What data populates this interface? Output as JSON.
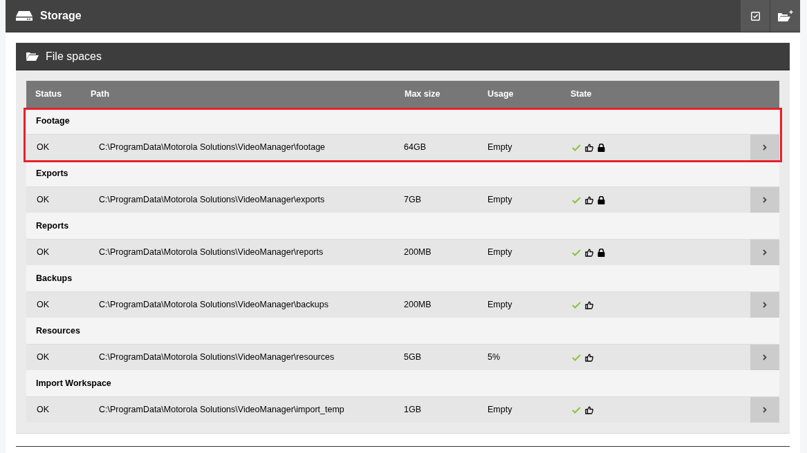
{
  "header": {
    "title": "Storage"
  },
  "panel": {
    "title": "File spaces"
  },
  "table": {
    "columns": [
      "Status",
      "Path",
      "Max size",
      "Usage",
      "State"
    ],
    "groups": [
      {
        "name": "Footage",
        "highlighted": true,
        "status": "OK",
        "path": "C:\\ProgramData\\Motorola Solutions\\VideoManager\\footage",
        "max_size": "64GB",
        "usage": "Empty",
        "healthy": true,
        "approved": true,
        "locked": true
      },
      {
        "name": "Exports",
        "highlighted": false,
        "status": "OK",
        "path": "C:\\ProgramData\\Motorola Solutions\\VideoManager\\exports",
        "max_size": "7GB",
        "usage": "Empty",
        "healthy": true,
        "approved": true,
        "locked": true
      },
      {
        "name": "Reports",
        "highlighted": false,
        "status": "OK",
        "path": "C:\\ProgramData\\Motorola Solutions\\VideoManager\\reports",
        "max_size": "200MB",
        "usage": "Empty",
        "healthy": true,
        "approved": true,
        "locked": true
      },
      {
        "name": "Backups",
        "highlighted": false,
        "status": "OK",
        "path": "C:\\ProgramData\\Motorola Solutions\\VideoManager\\backups",
        "max_size": "200MB",
        "usage": "Empty",
        "healthy": true,
        "approved": true,
        "locked": false
      },
      {
        "name": "Resources",
        "highlighted": false,
        "status": "OK",
        "path": "C:\\ProgramData\\Motorola Solutions\\VideoManager\\resources",
        "max_size": "5GB",
        "usage": "5%",
        "healthy": true,
        "approved": true,
        "locked": false
      },
      {
        "name": "Import Workspace",
        "highlighted": false,
        "status": "OK",
        "path": "C:\\ProgramData\\Motorola Solutions\\VideoManager\\import_temp",
        "max_size": "1GB",
        "usage": "Empty",
        "healthy": true,
        "approved": true,
        "locked": false
      }
    ]
  }
}
